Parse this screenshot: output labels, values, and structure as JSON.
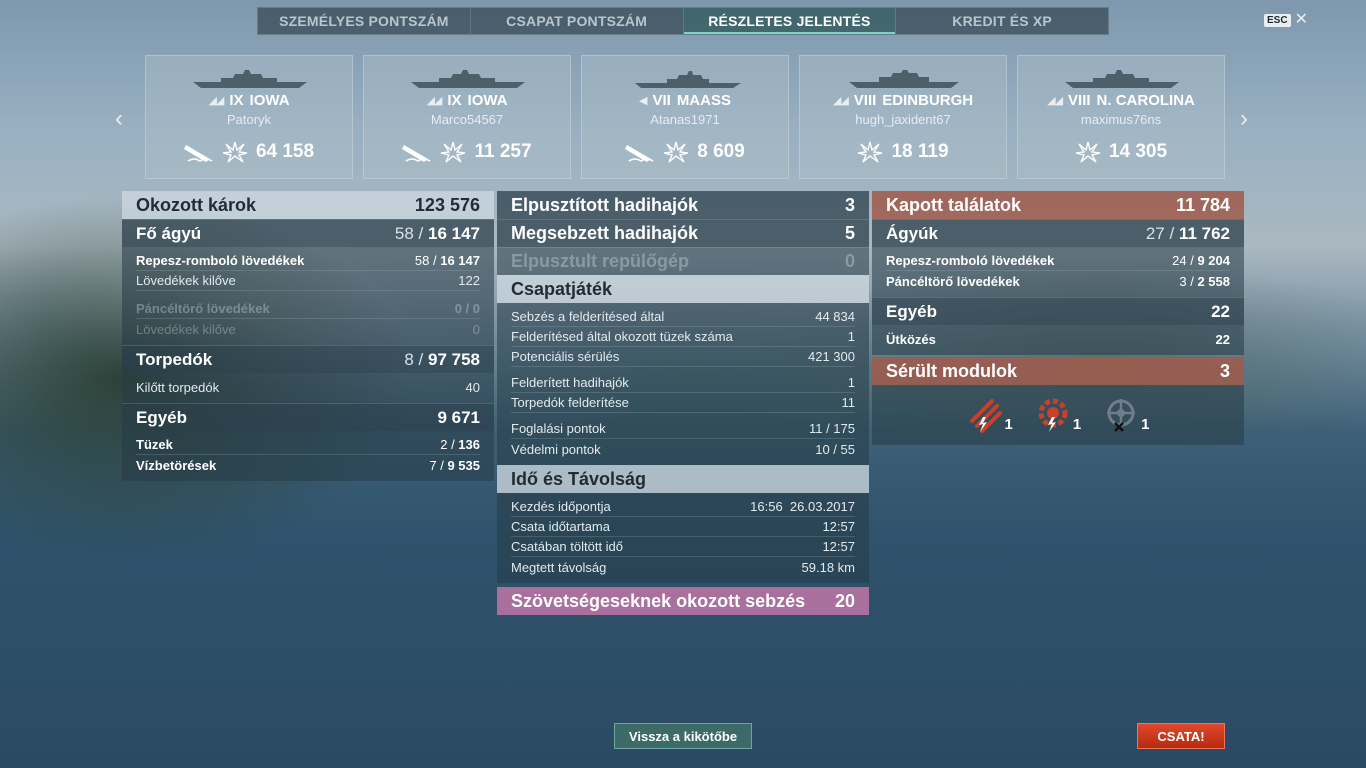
{
  "tabs": [
    {
      "label": "SZEMÉLYES PONTSZÁM",
      "active": false
    },
    {
      "label": "CSAPAT PONTSZÁM",
      "active": false
    },
    {
      "label": "RÉSZLETES JELENTÉS",
      "active": true
    },
    {
      "label": "KREDIT ÉS XP",
      "active": false
    }
  ],
  "esc": {
    "key": "ESC",
    "close": "✕"
  },
  "nav": {
    "prev": "‹",
    "next": "›"
  },
  "cards": [
    {
      "tier": "IX",
      "ship": "IOWA",
      "player": "Patoryk",
      "score": "64 158",
      "ribbon": true
    },
    {
      "tier": "IX",
      "ship": "IOWA",
      "player": "Marco54567",
      "score": "11 257",
      "ribbon": true
    },
    {
      "tier": "VII",
      "ship": "MAASS",
      "player": "Atanas1971",
      "score": "8 609",
      "ribbon": true
    },
    {
      "tier": "VIII",
      "ship": "EDINBURGH",
      "player": "hugh_jaxident67",
      "score": "18 119",
      "ribbon": false
    },
    {
      "tier": "VIII",
      "ship": "N. CAROLINA",
      "player": "maximus76ns",
      "score": "14 305",
      "ribbon": false
    }
  ],
  "damage": {
    "title": "Okozott károk",
    "total": "123 576",
    "main": {
      "label": "Fő ágyú",
      "hits": "58",
      "value": "16 147"
    },
    "he": {
      "label": "Repesz-romboló lövedékek",
      "hits": "58",
      "value": "16 147"
    },
    "he_fired": {
      "label": "Lövedékek kilőve",
      "value": "122"
    },
    "ap": {
      "label": "Páncéltörő lövedékek",
      "value": "0 / 0"
    },
    "ap_fired": {
      "label": "Lövedékek kilőve",
      "value": "0"
    },
    "torp": {
      "label": "Torpedók",
      "hits": "8",
      "value": "97 758"
    },
    "torp_fired": {
      "label": "Kilőtt torpedók",
      "value": "40"
    },
    "other": {
      "label": "Egyéb",
      "value": "9 671"
    },
    "fires": {
      "label": "Tüzek",
      "hits": "2",
      "value": "136"
    },
    "floods": {
      "label": "Vízbetörések",
      "hits": "7",
      "value": "9 535"
    }
  },
  "middle": {
    "destroyed": {
      "label": "Elpusztított hadihajók",
      "value": "3"
    },
    "damaged": {
      "label": "Megsebzett hadihajók",
      "value": "5"
    },
    "planes": {
      "label": "Elpusztult repülőgép",
      "value": "0"
    },
    "team": {
      "title": "Csapatjáték"
    },
    "team_rows": [
      {
        "label": "Sebzés a felderítésed által",
        "value": "44 834"
      },
      {
        "label": "Felderítésed által okozott tüzek száma",
        "value": "1"
      },
      {
        "label": "Potenciális sérülés",
        "value": "421 300"
      }
    ],
    "spot_rows": [
      {
        "label": "Felderített hadihajók",
        "value": "1"
      },
      {
        "label": "Torpedók felderítése",
        "value": "11"
      }
    ],
    "cap_rows": [
      {
        "label": "Foglalási pontok",
        "value": "11 / 175"
      },
      {
        "label": "Védelmi pontok",
        "value": "10 / 55"
      }
    ],
    "time": {
      "title": "Idő és Távolság"
    },
    "time_rows": [
      {
        "label": "Kezdés időpontja",
        "value": "16:56  26.03.2017"
      },
      {
        "label": "Csata időtartama",
        "value": "12:57"
      },
      {
        "label": "Csatában töltött idő",
        "value": "12:57"
      },
      {
        "label": "Megtett távolság",
        "value": "59.18 km"
      }
    ],
    "ally": {
      "label": "Szövetségeseknek okozott sebzés",
      "value": "20"
    }
  },
  "received": {
    "title": "Kapott találatok",
    "total": "11 784",
    "guns": {
      "label": "Ágyúk",
      "hits": "27",
      "value": "11 762"
    },
    "he": {
      "label": "Repesz-romboló lövedékek",
      "hits": "24",
      "value": "9 204"
    },
    "ap": {
      "label": "Páncéltörő lövedékek",
      "hits": "3",
      "value": "2 558"
    },
    "other": {
      "label": "Egyéb",
      "value": "22"
    },
    "ram": {
      "label": "Ütközés",
      "value": "22"
    },
    "modules": {
      "label": "Sérült modulok",
      "value": "3"
    },
    "module_icons": [
      {
        "icon": "torpedo-tubes-icon",
        "count": "1"
      },
      {
        "icon": "engine-icon",
        "count": "1"
      },
      {
        "icon": "steering-gear-icon",
        "count": "1"
      }
    ]
  },
  "buttons": {
    "back": "Vissza a kikötőbe",
    "battle": "CSATA!"
  }
}
